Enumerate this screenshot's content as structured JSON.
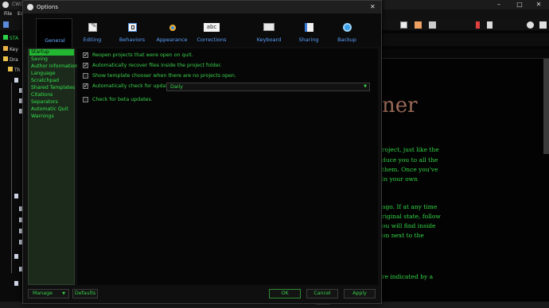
{
  "app": {
    "title": "CWD",
    "menu": [
      "File",
      "Ed"
    ],
    "binder": [
      "STA",
      "Key",
      "Dra",
      "Th"
    ],
    "doc_big": "ner",
    "doc_lines": [
      "roject, just like the",
      "duce you to all the",
      "them. Once you've",
      "in your own",
      "ago. If at any time",
      "riginal state, follow",
      "ou will find inside",
      "on next to the",
      "re indicated by a"
    ],
    "status_cancel": "Cancel"
  },
  "dialog": {
    "title": "Options",
    "close": "✕",
    "tabs": [
      {
        "label": "General",
        "icon": "general-icon"
      },
      {
        "label": "Editing",
        "icon": "editing-icon"
      },
      {
        "label": "Behaviors",
        "icon": "behaviors-icon"
      },
      {
        "label": "Appearance",
        "icon": "appearance-icon"
      },
      {
        "label": "Corrections",
        "icon": "corrections-icon",
        "glyph": "abc"
      },
      {
        "label": "Keyboard",
        "icon": "keyboard-icon"
      },
      {
        "label": "Sharing",
        "icon": "sharing-icon"
      },
      {
        "label": "Backup",
        "icon": "backup-icon"
      }
    ],
    "sidebar": [
      "Startup",
      "Saving",
      "Author Information",
      "Language",
      "Scratchpad",
      "Shared Templates",
      "Citations",
      "Separators",
      "Automatic Quit",
      "Warnings"
    ],
    "selected_section": "Startup",
    "options": [
      {
        "label": "Reopen projects that were open on quit.",
        "checked": true
      },
      {
        "label": "Automatically recover files inside the project folder.",
        "checked": true
      },
      {
        "label": "Show template chooser when there are no projects open.",
        "checked": false
      },
      {
        "label": "Automatically check for updates:",
        "checked": true
      },
      {
        "label": "Check for beta updates.",
        "checked": false
      }
    ],
    "update_frequency": "Daily",
    "buttons": {
      "manage": "Manage",
      "defaults": "Defaults",
      "ok": "OK",
      "cancel": "Cancel",
      "apply": "Apply"
    },
    "colors": {
      "accent_green": "#34e24a",
      "selected_bg": "#22b832",
      "tab_label": "#5aa0ff"
    }
  }
}
